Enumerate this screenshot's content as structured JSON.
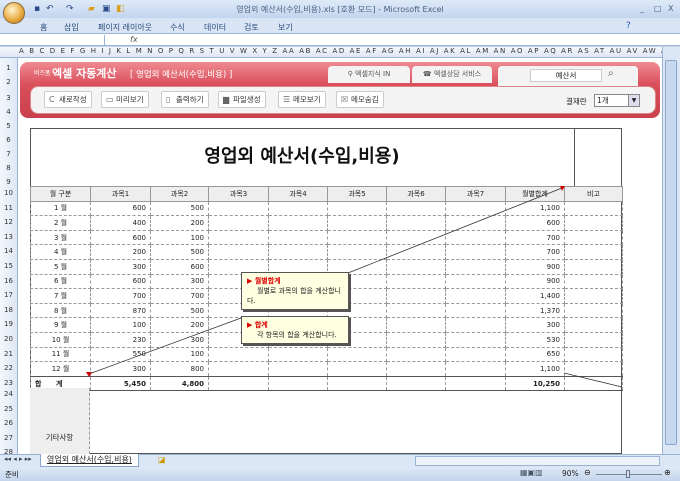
{
  "window": {
    "title": "영업외 예산서(수입,비용).xls  [호환 모드] - Microsoft Excel",
    "controls": [
      "_",
      "□",
      "X"
    ]
  },
  "ribbon_tabs": [
    "홈",
    "삽입",
    "페이지 레이아웃",
    "수식",
    "데이터",
    "검토",
    "보기"
  ],
  "formula_bar": {
    "fx": "fx"
  },
  "columns": "A B C D E F G H I J K L M N O P Q R S T U V W X Y Z AA AB AC AD AE AF AG AH AI AJ AK AL AM AN AO AP AQ AR AS AT AU AV AW AX AY AZ BB BC BD",
  "rows": [
    "1",
    "2",
    "3",
    "4",
    "5",
    "6",
    "7",
    "8",
    "9",
    "10",
    "11",
    "12",
    "13",
    "14",
    "15",
    "16",
    "17",
    "18",
    "19",
    "20",
    "21",
    "22",
    "23",
    "24",
    "25",
    "26",
    "27",
    "28"
  ],
  "banner": {
    "brand_small": "비즈폼",
    "brand": "엑셀 자동계산",
    "doc_title": "[ 영업외 예산서(수입,비용) ]",
    "link1": "엑셀지식 IN",
    "link2": "엑셀상담 서비스",
    "search_value": "예산서",
    "buttons": [
      "새로작성",
      "미리보기",
      "출력하기",
      "파일생성",
      "메모보기",
      "메모숨김"
    ],
    "settle_label": "결재란",
    "settle_value": "1개"
  },
  "sheet": {
    "title": "영업외 예산서(수입,비용)",
    "headers": [
      "월 구분",
      "과목1",
      "과목2",
      "과목3",
      "과목4",
      "과목5",
      "과목6",
      "과목7",
      "월별합계",
      "비고"
    ],
    "rows": [
      [
        "1 월",
        "600",
        "500",
        "1,100"
      ],
      [
        "2 월",
        "400",
        "200",
        "600"
      ],
      [
        "3 월",
        "600",
        "100",
        "700"
      ],
      [
        "4 월",
        "200",
        "500",
        "700"
      ],
      [
        "5 월",
        "300",
        "600",
        "900"
      ],
      [
        "6 월",
        "600",
        "300",
        "900"
      ],
      [
        "7 월",
        "700",
        "700",
        "1,400"
      ],
      [
        "8 월",
        "870",
        "500",
        "1,370"
      ],
      [
        "9 월",
        "100",
        "200",
        "300"
      ],
      [
        "10 월",
        "230",
        "300",
        "530"
      ],
      [
        "11 월",
        "550",
        "100",
        "650"
      ],
      [
        "12 월",
        "300",
        "800",
        "1,100"
      ]
    ],
    "total": [
      "합      계",
      "5,450",
      "4,800",
      "10,250"
    ],
    "etc_label": "기타사항"
  },
  "notes": [
    {
      "title": "월별합계",
      "body": "월별로 과목의 합을 계산합니다."
    },
    {
      "title": "합계",
      "body": "각 항목의 합을 계산합니다."
    }
  ],
  "sheet_tab": "영업외 예산서(수입,비용)",
  "status": {
    "ready": "준비",
    "zoom": "90%"
  }
}
